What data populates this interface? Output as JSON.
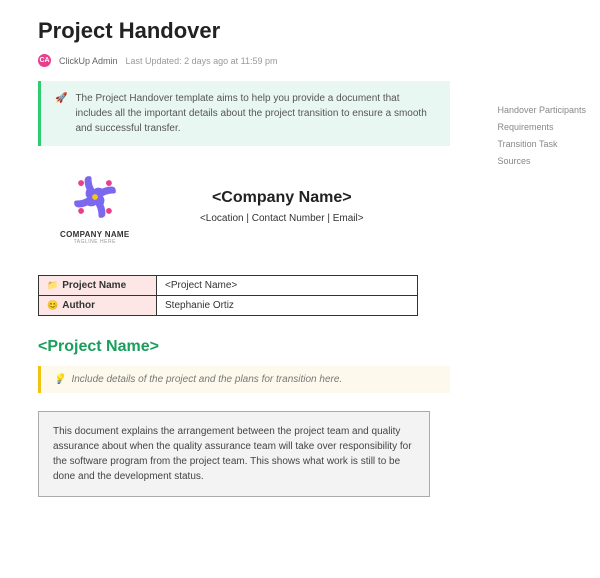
{
  "header": {
    "title": "Project Handover",
    "avatar_initials": "CA",
    "author": "ClickUp Admin",
    "last_updated": "Last Updated: 2 days ago at 11:59 pm"
  },
  "intro": {
    "icon": "🚀",
    "text": "The Project Handover template aims to help you provide a document that includes all the important details about the project transition to ensure a smooth and successful transfer."
  },
  "company": {
    "logo_name": "COMPANY NAME",
    "logo_tagline": "TAGLINE HERE",
    "name_title": "<Company Name>",
    "subline": "<Location | Contact Number | Email>"
  },
  "info_table": {
    "rows": [
      {
        "icon": "📁",
        "label": "Project Name",
        "value": "<Project Name>"
      },
      {
        "icon": "😊",
        "label": "Author",
        "value": "Stephanie Ortiz"
      }
    ]
  },
  "section": {
    "title": "<Project Name>",
    "hint_icon": "💡",
    "hint": "Include details of the project and the plans for transition here.",
    "description": "This document explains the arrangement between the project team and quality assurance about when the quality assurance team will take over responsibility for the software program from the project team. This shows what work is still to be done and the development status."
  },
  "nav": {
    "items": [
      "Handover Participants",
      "Requirements",
      "Transition Task",
      "Sources"
    ]
  }
}
